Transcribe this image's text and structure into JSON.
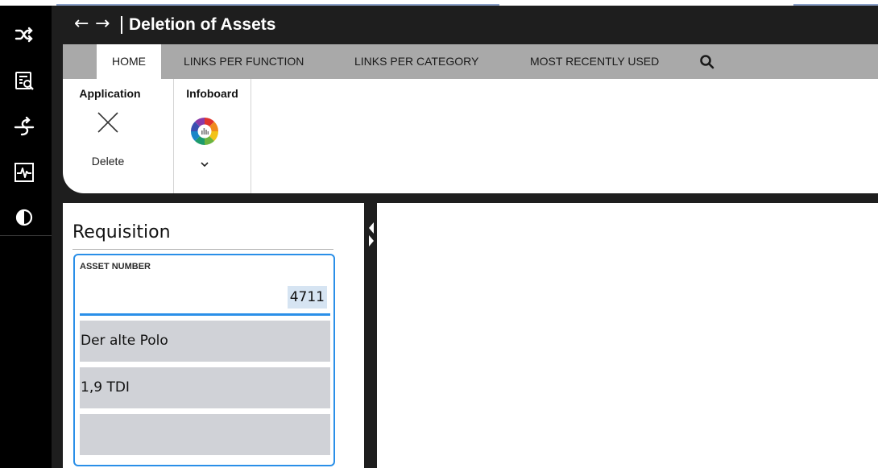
{
  "window": {
    "title": "Deletion of Assets",
    "back_glyph": "←",
    "forward_glyph": "→"
  },
  "rail": {
    "icons": [
      "shuffle-icon",
      "report-search-icon",
      "link-switch-icon",
      "activity-monitor-icon",
      "contrast-icon"
    ]
  },
  "ribbon": {
    "tabs": [
      "HOME",
      "LINKS PER FUNCTION",
      "LINKS PER CATEGORY",
      "MOST RECENTLY USED"
    ],
    "active_tab": "HOME",
    "groups": {
      "application": {
        "label": "Application",
        "delete_label": "Delete"
      },
      "infoboard": {
        "label": "Infoboard"
      }
    }
  },
  "main": {
    "section_title": "Requisition",
    "asset_number": {
      "label": "ASSET NUMBER",
      "value": "4711"
    },
    "fields": [
      "Der alte Polo",
      "1,9 TDI",
      ""
    ]
  },
  "colors": {
    "accent": "#2a8fe8",
    "ribbon_tabs_bg": "#a9a9a9",
    "field_bg": "#d0d2d7",
    "dark_bg": "#1e1e1e"
  }
}
